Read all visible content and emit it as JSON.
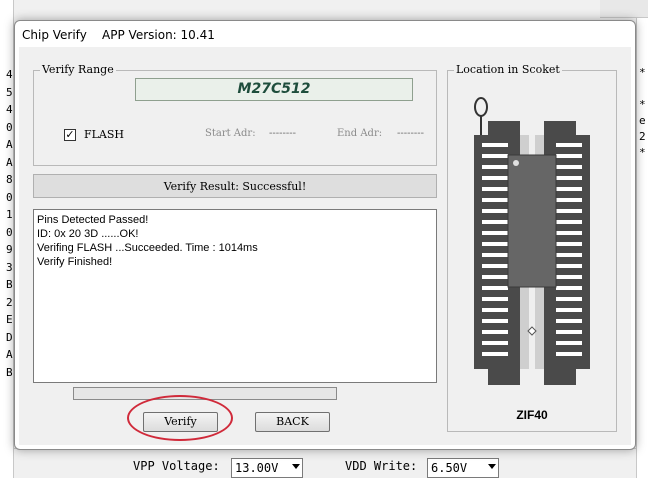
{
  "dialog": {
    "title": "Chip Verify    APP Version: 10.41"
  },
  "verify_range": {
    "title": "Verify Range",
    "chip_name": "M27C512",
    "flash_label": "FLASH",
    "flash_checked": true,
    "flash_check_glyph": "✓",
    "start_adr_label": "Start Adr:",
    "start_adr_value": "--------",
    "end_adr_label": "End Adr:",
    "end_adr_value": "--------"
  },
  "result": {
    "text": "Verify Result: Successful!"
  },
  "log": {
    "lines": [
      "Pins Detected Passed!",
      "ID: 0x 20 3D ......OK!",
      "Verifing FLASH ...Succeeded. Time : 1014ms",
      "Verify Finished!"
    ]
  },
  "progress": {
    "fraction": 0.0
  },
  "buttons": {
    "verify_label": "Verify",
    "back_label": "BACK"
  },
  "location": {
    "title": "Location in Scoket",
    "socket_label": "ZIF40"
  },
  "background_app": {
    "left_chars": [
      "4",
      "5",
      "4",
      "0",
      "A",
      "A",
      "8",
      "0",
      "1",
      "0",
      "9",
      "3",
      "B",
      "2",
      "E",
      "D",
      "A",
      "B"
    ],
    "right_chars": [
      "*",
      "*",
      "e",
      "2",
      "*"
    ],
    "vpp_label": "VPP Voltage:",
    "vpp_value": "13.00V",
    "vdd_label": "VDD Write:",
    "vdd_value": "6.50V"
  },
  "colors": {
    "accent_highlight": "#d02a3a",
    "chip_name_text": "#1e4d3c",
    "socket_body": "#4a4a4a",
    "chip_body": "#666666"
  },
  "icons": {
    "socket_diagram": "zif40-socket-diagram"
  }
}
